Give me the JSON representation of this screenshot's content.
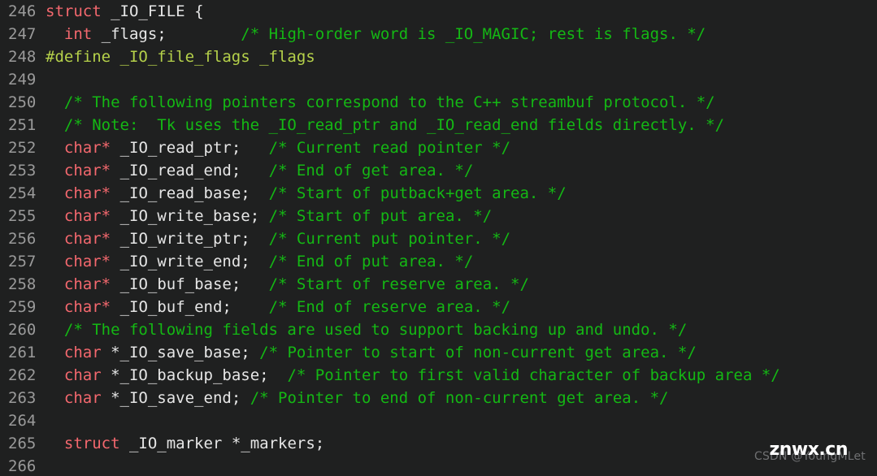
{
  "editor": {
    "background_color": "#1f2020",
    "gutter_color": "#9a9a9a",
    "default_text_color": "#d6d6d6",
    "comment_color": "#14b814",
    "keyword_color": "#f4686e",
    "preprocessor_color": "#b5d14a",
    "first_line_number": 246,
    "last_line_number": 266
  },
  "lines": [
    {
      "number": "246",
      "tokens": [
        {
          "t": "kw",
          "s": "struct"
        },
        {
          "t": "src",
          "s": " "
        },
        {
          "t": "id",
          "s": "_IO_FILE"
        },
        {
          "t": "src",
          "s": " "
        },
        {
          "t": "pun",
          "s": "{"
        }
      ]
    },
    {
      "number": "247",
      "tokens": [
        {
          "t": "src",
          "s": "  "
        },
        {
          "t": "kw",
          "s": "int"
        },
        {
          "t": "src",
          "s": " "
        },
        {
          "t": "id",
          "s": "_flags;"
        },
        {
          "t": "src",
          "s": "        "
        },
        {
          "t": "cm",
          "s": "/* High-order word is _IO_MAGIC; rest is flags. */"
        }
      ]
    },
    {
      "number": "248",
      "tokens": [
        {
          "t": "pp",
          "s": "#define _IO_file_flags _flags"
        }
      ]
    },
    {
      "number": "249",
      "tokens": []
    },
    {
      "number": "250",
      "tokens": [
        {
          "t": "src",
          "s": "  "
        },
        {
          "t": "cm",
          "s": "/* The following pointers correspond to the C++ streambuf protocol. */"
        }
      ]
    },
    {
      "number": "251",
      "tokens": [
        {
          "t": "src",
          "s": "  "
        },
        {
          "t": "cm",
          "s": "/* Note:  Tk uses the _IO_read_ptr and _IO_read_end fields directly. */"
        }
      ]
    },
    {
      "number": "252",
      "tokens": [
        {
          "t": "src",
          "s": "  "
        },
        {
          "t": "kw",
          "s": "char"
        },
        {
          "t": "op",
          "s": "*"
        },
        {
          "t": "src",
          "s": " "
        },
        {
          "t": "id",
          "s": "_IO_read_ptr;"
        },
        {
          "t": "src",
          "s": "   "
        },
        {
          "t": "cm",
          "s": "/* Current read pointer */"
        }
      ]
    },
    {
      "number": "253",
      "tokens": [
        {
          "t": "src",
          "s": "  "
        },
        {
          "t": "kw",
          "s": "char"
        },
        {
          "t": "op",
          "s": "*"
        },
        {
          "t": "src",
          "s": " "
        },
        {
          "t": "id",
          "s": "_IO_read_end;"
        },
        {
          "t": "src",
          "s": "   "
        },
        {
          "t": "cm",
          "s": "/* End of get area. */"
        }
      ]
    },
    {
      "number": "254",
      "tokens": [
        {
          "t": "src",
          "s": "  "
        },
        {
          "t": "kw",
          "s": "char"
        },
        {
          "t": "op",
          "s": "*"
        },
        {
          "t": "src",
          "s": " "
        },
        {
          "t": "id",
          "s": "_IO_read_base;"
        },
        {
          "t": "src",
          "s": "  "
        },
        {
          "t": "cm",
          "s": "/* Start of putback+get area. */"
        }
      ]
    },
    {
      "number": "255",
      "tokens": [
        {
          "t": "src",
          "s": "  "
        },
        {
          "t": "kw",
          "s": "char"
        },
        {
          "t": "op",
          "s": "*"
        },
        {
          "t": "src",
          "s": " "
        },
        {
          "t": "id",
          "s": "_IO_write_base;"
        },
        {
          "t": "src",
          "s": " "
        },
        {
          "t": "cm",
          "s": "/* Start of put area. */"
        }
      ]
    },
    {
      "number": "256",
      "tokens": [
        {
          "t": "src",
          "s": "  "
        },
        {
          "t": "kw",
          "s": "char"
        },
        {
          "t": "op",
          "s": "*"
        },
        {
          "t": "src",
          "s": " "
        },
        {
          "t": "id",
          "s": "_IO_write_ptr;"
        },
        {
          "t": "src",
          "s": "  "
        },
        {
          "t": "cm",
          "s": "/* Current put pointer. */"
        }
      ]
    },
    {
      "number": "257",
      "tokens": [
        {
          "t": "src",
          "s": "  "
        },
        {
          "t": "kw",
          "s": "char"
        },
        {
          "t": "op",
          "s": "*"
        },
        {
          "t": "src",
          "s": " "
        },
        {
          "t": "id",
          "s": "_IO_write_end;"
        },
        {
          "t": "src",
          "s": "  "
        },
        {
          "t": "cm",
          "s": "/* End of put area. */"
        }
      ]
    },
    {
      "number": "258",
      "tokens": [
        {
          "t": "src",
          "s": "  "
        },
        {
          "t": "kw",
          "s": "char"
        },
        {
          "t": "op",
          "s": "*"
        },
        {
          "t": "src",
          "s": " "
        },
        {
          "t": "id",
          "s": "_IO_buf_base;"
        },
        {
          "t": "src",
          "s": "   "
        },
        {
          "t": "cm",
          "s": "/* Start of reserve area. */"
        }
      ]
    },
    {
      "number": "259",
      "tokens": [
        {
          "t": "src",
          "s": "  "
        },
        {
          "t": "kw",
          "s": "char"
        },
        {
          "t": "op",
          "s": "*"
        },
        {
          "t": "src",
          "s": " "
        },
        {
          "t": "id",
          "s": "_IO_buf_end;"
        },
        {
          "t": "src",
          "s": "    "
        },
        {
          "t": "cm",
          "s": "/* End of reserve area. */"
        }
      ]
    },
    {
      "number": "260",
      "tokens": [
        {
          "t": "src",
          "s": "  "
        },
        {
          "t": "cm",
          "s": "/* The following fields are used to support backing up and undo. */"
        }
      ]
    },
    {
      "number": "261",
      "tokens": [
        {
          "t": "src",
          "s": "  "
        },
        {
          "t": "kw",
          "s": "char"
        },
        {
          "t": "src",
          "s": " "
        },
        {
          "t": "id",
          "s": "*_IO_save_base;"
        },
        {
          "t": "src",
          "s": " "
        },
        {
          "t": "cm",
          "s": "/* Pointer to start of non-current get area. */"
        }
      ]
    },
    {
      "number": "262",
      "tokens": [
        {
          "t": "src",
          "s": "  "
        },
        {
          "t": "kw",
          "s": "char"
        },
        {
          "t": "src",
          "s": " "
        },
        {
          "t": "id",
          "s": "*_IO_backup_base;"
        },
        {
          "t": "src",
          "s": "  "
        },
        {
          "t": "cm",
          "s": "/* Pointer to first valid character of backup area */"
        }
      ]
    },
    {
      "number": "263",
      "tokens": [
        {
          "t": "src",
          "s": "  "
        },
        {
          "t": "kw",
          "s": "char"
        },
        {
          "t": "src",
          "s": " "
        },
        {
          "t": "id",
          "s": "*_IO_save_end;"
        },
        {
          "t": "src",
          "s": " "
        },
        {
          "t": "cm",
          "s": "/* Pointer to end of non-current get area. */"
        }
      ]
    },
    {
      "number": "264",
      "tokens": []
    },
    {
      "number": "265",
      "tokens": [
        {
          "t": "src",
          "s": "  "
        },
        {
          "t": "kw",
          "s": "struct"
        },
        {
          "t": "src",
          "s": " "
        },
        {
          "t": "id",
          "s": "_IO_marker"
        },
        {
          "t": "src",
          "s": " "
        },
        {
          "t": "id",
          "s": "*_markers;"
        }
      ]
    },
    {
      "number": "266",
      "tokens": []
    }
  ],
  "watermarks": {
    "csdn": "CSDN @YoungMLet",
    "site": "znwx.cn"
  }
}
